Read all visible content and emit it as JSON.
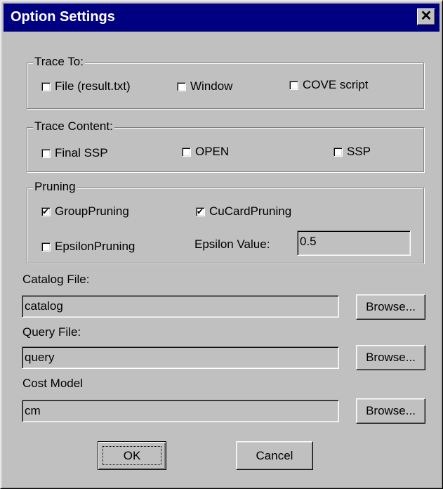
{
  "window": {
    "title": "Option Settings",
    "close_glyph": "✕"
  },
  "trace_to": {
    "legend": "Trace To:",
    "options": [
      {
        "label": "File (result.txt)",
        "checked": false
      },
      {
        "label": "Window",
        "checked": false
      },
      {
        "label": "COVE script",
        "checked": false
      }
    ]
  },
  "trace_content": {
    "legend": "Trace Content:",
    "options": [
      {
        "label": "Final SSP",
        "checked": false
      },
      {
        "label": "OPEN",
        "checked": false
      },
      {
        "label": "SSP",
        "checked": false
      }
    ]
  },
  "pruning": {
    "legend": "Pruning",
    "options": [
      {
        "label": "GroupPruning",
        "checked": true
      },
      {
        "label": "CuCardPruning",
        "checked": true
      },
      {
        "label": "EpsilonPruning",
        "checked": false
      }
    ],
    "epsilon_label": "Epsilon Value:",
    "epsilon_value": "0.5"
  },
  "files": [
    {
      "label": "Catalog File:",
      "value": "catalog",
      "browse": "Browse..."
    },
    {
      "label": "Query File:",
      "value": "query",
      "browse": "Browse..."
    },
    {
      "label": "Cost Model",
      "value": "cm",
      "browse": "Browse..."
    }
  ],
  "buttons": {
    "ok": "OK",
    "cancel": "Cancel"
  }
}
